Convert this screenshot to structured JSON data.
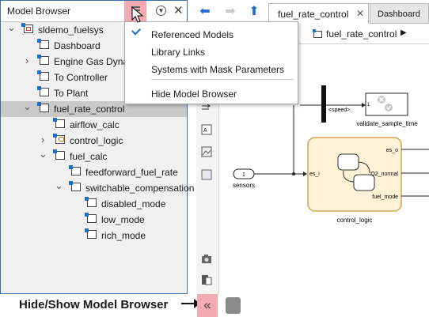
{
  "model_browser": {
    "title": "Model Browser",
    "tree": [
      {
        "label": "sldemo_fuelsys",
        "icon": "model-top-icon",
        "toggle": "expanded"
      },
      {
        "label": "Dashboard",
        "icon": "subsystem-icon",
        "toggle": "none"
      },
      {
        "label": "Engine Gas Dynamics",
        "icon": "subsystem-icon",
        "toggle": "collapsed"
      },
      {
        "label": "To Controller",
        "icon": "subsystem-icon",
        "toggle": "none"
      },
      {
        "label": "To Plant",
        "icon": "subsystem-icon",
        "toggle": "none"
      },
      {
        "label": "fuel_rate_control",
        "icon": "subsystem-icon",
        "toggle": "expanded",
        "selected": true
      },
      {
        "label": "airflow_calc",
        "icon": "subsystem-icon",
        "toggle": "none"
      },
      {
        "label": "control_logic",
        "icon": "stateflow-chart-icon",
        "toggle": "collapsed"
      },
      {
        "label": "fuel_calc",
        "icon": "subsystem-icon",
        "toggle": "expanded"
      },
      {
        "label": "feedforward_fuel_rate",
        "icon": "subsystem-icon",
        "toggle": "none"
      },
      {
        "label": "switchable_compensation",
        "icon": "subsystem-icon",
        "toggle": "expanded"
      },
      {
        "label": "disabled_mode",
        "icon": "subsystem-icon",
        "toggle": "none"
      },
      {
        "label": "low_mode",
        "icon": "subsystem-icon",
        "toggle": "none"
      },
      {
        "label": "rich_mode",
        "icon": "subsystem-icon",
        "toggle": "none"
      }
    ]
  },
  "menu": {
    "items": [
      {
        "label": "Referenced Models",
        "checked": true
      },
      {
        "label": "Library Links",
        "checked": false
      },
      {
        "label": "Systems with Mask Parameters",
        "checked": false
      },
      {
        "label": "Hide Model Browser",
        "checked": false
      }
    ]
  },
  "tabs": [
    {
      "label": "fuel_rate_control",
      "active": true
    },
    {
      "label": "Dashboard",
      "active": false
    }
  ],
  "breadcrumb": {
    "label": "fuel_rate_control"
  },
  "diagram": {
    "speed_label": "<speed>",
    "validate_label": "validate_sample_time",
    "validate_port": "1",
    "sensors_label": "sensors",
    "sensors_port": "1",
    "chart_label": "control_logic",
    "chart_input": "es_i",
    "chart_out_1": "es_o",
    "chart_out_2": "O2_normal",
    "chart_out_3": "fuel_mode"
  },
  "annotation": {
    "label": "Hide/Show Model Browser"
  },
  "colors": {
    "highlight": "#f2aab0",
    "accent": "#1f6fd1",
    "chart_fill": "#fff2d6",
    "chart_border": "#d4a35a"
  }
}
